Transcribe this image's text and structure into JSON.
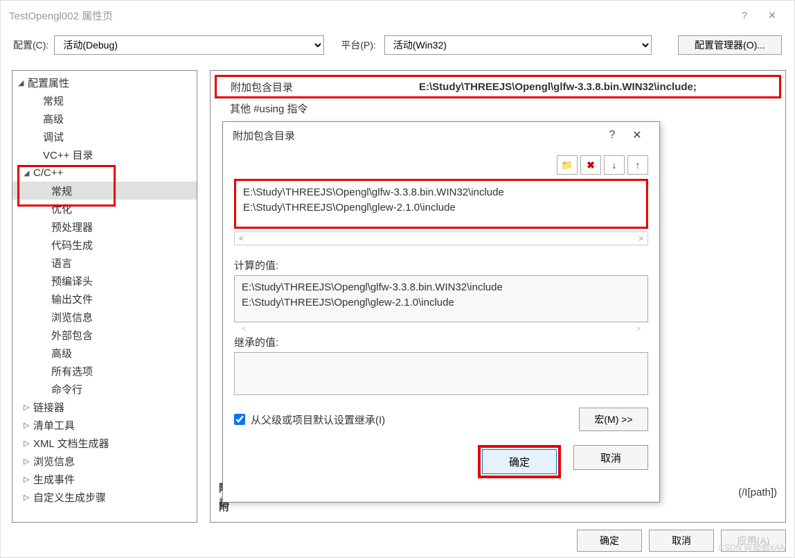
{
  "window": {
    "title": "TestOpengl002 属性页"
  },
  "config_row": {
    "config_label": "配置(C):",
    "config_value": "活动(Debug)",
    "platform_label": "平台(P):",
    "platform_value": "活动(Win32)",
    "config_manager_btn": "配置管理器(O)..."
  },
  "tree": {
    "root": "配置属性",
    "l1": {
      "general": "常规",
      "advanced": "高级",
      "debug": "调试",
      "vcpp": "VC++ 目录",
      "cpp": "C/C++",
      "linker": "链接器",
      "manifest": "清单工具",
      "xmldoc": "XML 文档生成器",
      "browse": "浏览信息",
      "buildevent": "生成事件",
      "custombuild": "自定义生成步骤"
    },
    "cpp_children": {
      "general": "常规",
      "optimize": "优化",
      "preproc": "预处理器",
      "codegen": "代码生成",
      "lang": "语言",
      "pch": "预编译头",
      "output": "输出文件",
      "browseinfo": "浏览信息",
      "external": "外部包含",
      "advanced": "高级",
      "all": "所有选项",
      "cmdline": "命令行"
    }
  },
  "prop_grid": {
    "row1_label": "附加包含目录",
    "row1_value": "E:\\Study\\THREEJS\\Opengl\\glfw-3.3.8.bin.WIN32\\include;",
    "row2_label": "其他 #using 指令",
    "bottom_label": "附",
    "bottom_desc": "指",
    "bottom_hint": "(/I[path])"
  },
  "dialog": {
    "title": "附加包含目录",
    "paths": [
      "E:\\Study\\THREEJS\\Opengl\\glfw-3.3.8.bin.WIN32\\include",
      "E:\\Study\\THREEJS\\Opengl\\glew-2.1.0\\include"
    ],
    "calc_label": "计算的值:",
    "calc_values": [
      "E:\\Study\\THREEJS\\Opengl\\glfw-3.3.8.bin.WIN32\\include",
      "E:\\Study\\THREEJS\\Opengl\\glew-2.1.0\\include"
    ],
    "inherit_label": "继承的值:",
    "inherit_checkbox": "从父级或项目默认设置继承(I)",
    "macro_btn": "宏(M) >>",
    "ok_btn": "确定",
    "cancel_btn": "取消"
  },
  "window_buttons": {
    "ok": "确定",
    "cancel": "取消",
    "apply": "应用(A)"
  },
  "watermark": "CSDN @仙魁XAN"
}
